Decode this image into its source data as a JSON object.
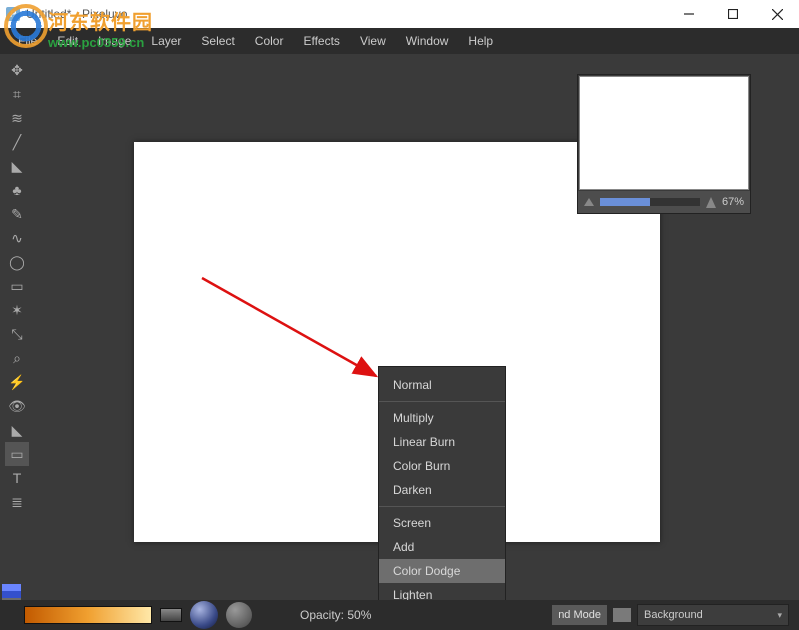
{
  "titlebar": {
    "title": "Untitled* - Pixeluvo"
  },
  "menu": {
    "items": [
      "File",
      "Edit",
      "Image",
      "Layer",
      "Select",
      "Color",
      "Effects",
      "View",
      "Window",
      "Help"
    ]
  },
  "watermark": {
    "cn": "河东软件园",
    "url": "www.pc0359.cn"
  },
  "nav": {
    "zoom": "67%"
  },
  "blendmenu": {
    "group1": [
      "Normal"
    ],
    "group2": [
      "Multiply",
      "Linear Burn",
      "Color Burn",
      "Darken"
    ],
    "group3": [
      "Screen",
      "Add",
      "Color Dodge",
      "Lighten"
    ],
    "highlight": "Color Dodge"
  },
  "bottombar": {
    "opacity": "Opacity: 50%",
    "blendmode_fragment": "nd Mode",
    "layer_selected": "Background"
  },
  "palette": [
    "#6a85ff",
    "#3450cc",
    "#6b6b6b",
    "#b08030"
  ]
}
